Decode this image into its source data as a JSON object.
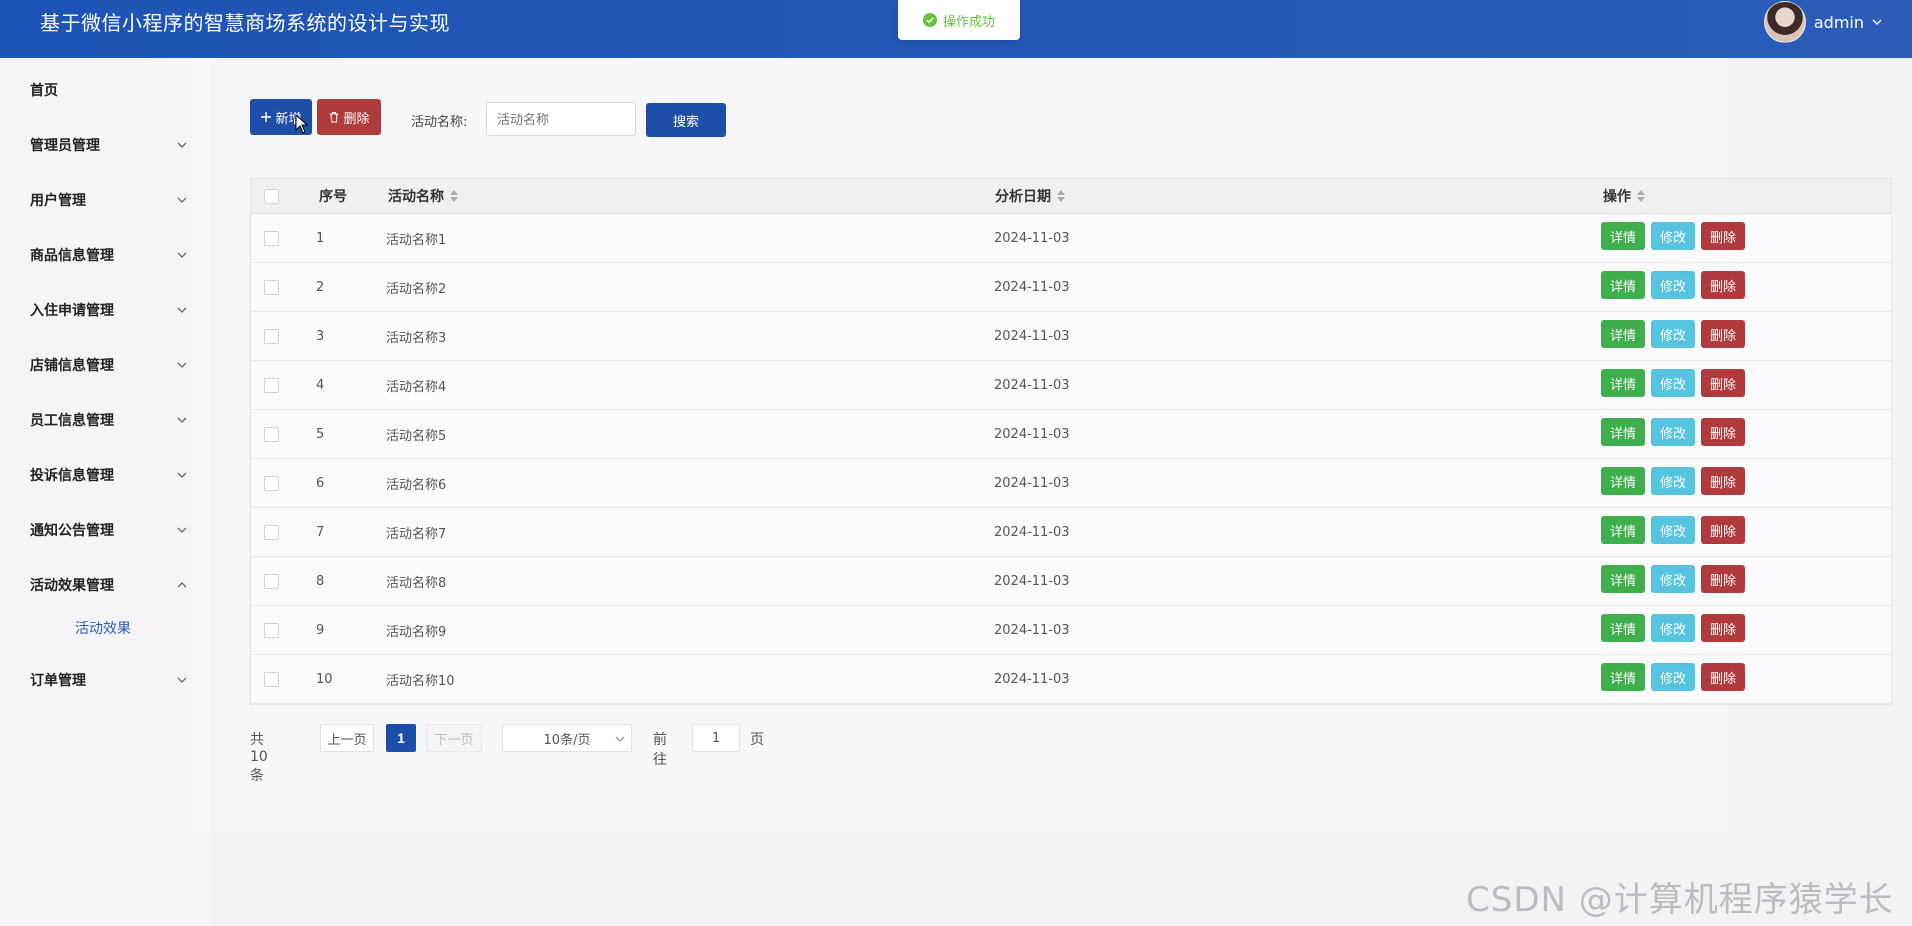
{
  "header": {
    "title": "基于微信小程序的智慧商场系统的设计与实现",
    "user": "admin"
  },
  "toast": {
    "message": "操作成功"
  },
  "sidebar": {
    "items": [
      {
        "label": "首页"
      },
      {
        "label": "管理员管理"
      },
      {
        "label": "用户管理"
      },
      {
        "label": "商品信息管理"
      },
      {
        "label": "入住申请管理"
      },
      {
        "label": "店铺信息管理"
      },
      {
        "label": "员工信息管理"
      },
      {
        "label": "投诉信息管理"
      },
      {
        "label": "通知公告管理"
      },
      {
        "label": "活动效果管理"
      },
      {
        "label": "订单管理"
      }
    ],
    "sub_item": "活动效果"
  },
  "toolbar": {
    "add_label": "新增",
    "delete_label": "删除",
    "search_label": "活动名称:",
    "search_placeholder": "活动名称",
    "search_button": "搜索"
  },
  "table": {
    "columns": [
      "序号",
      "活动名称",
      "分析日期",
      "操作"
    ],
    "rows": [
      {
        "no": "1",
        "name": "活动名称1",
        "date": "2024-11-03"
      },
      {
        "no": "2",
        "name": "活动名称2",
        "date": "2024-11-03"
      },
      {
        "no": "3",
        "name": "活动名称3",
        "date": "2024-11-03"
      },
      {
        "no": "4",
        "name": "活动名称4",
        "date": "2024-11-03"
      },
      {
        "no": "5",
        "name": "活动名称5",
        "date": "2024-11-03"
      },
      {
        "no": "6",
        "name": "活动名称6",
        "date": "2024-11-03"
      },
      {
        "no": "7",
        "name": "活动名称7",
        "date": "2024-11-03"
      },
      {
        "no": "8",
        "name": "活动名称8",
        "date": "2024-11-03"
      },
      {
        "no": "9",
        "name": "活动名称9",
        "date": "2024-11-03"
      },
      {
        "no": "10",
        "name": "活动名称10",
        "date": "2024-11-03"
      }
    ],
    "actions": {
      "detail": "详情",
      "edit": "修改",
      "delete": "删除"
    }
  },
  "pagination": {
    "total": "共 10 条",
    "prev": "上一页",
    "current": "1",
    "next": "下一页",
    "page_size": "10条/页",
    "goto": "前往",
    "goto_value": "1",
    "page_suffix": "页"
  },
  "watermark": "CSDN @计算机程序猿学长",
  "colors": {
    "header": "#1e54b5",
    "primary": "#1e4fa8",
    "danger": "#b13a3c",
    "success": "#3fae4c",
    "info": "#56c4df"
  }
}
